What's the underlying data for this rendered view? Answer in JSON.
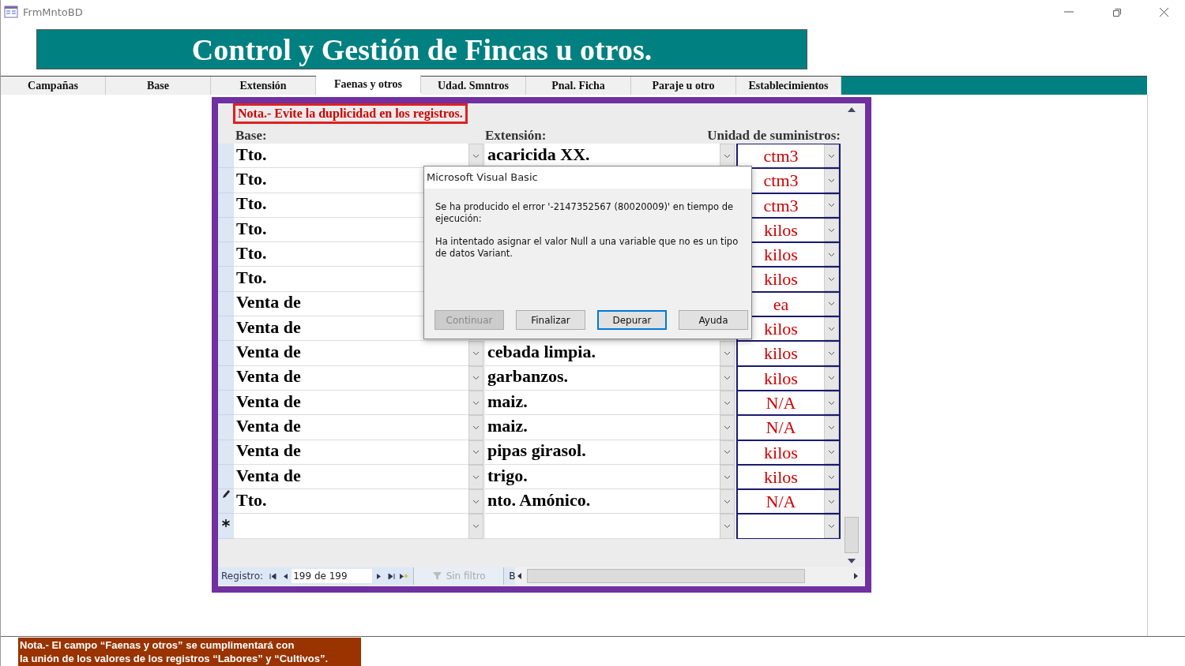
{
  "window": {
    "title": "FrmMntoBD"
  },
  "header": {
    "title": "Control y Gestión de Fincas u otros."
  },
  "tabs": [
    {
      "label": "Campañas",
      "selected": false
    },
    {
      "label": "Base",
      "selected": false
    },
    {
      "label": "Extensión",
      "selected": false
    },
    {
      "label": "Faenas y otros",
      "selected": true
    },
    {
      "label": "Udad. Smntros",
      "selected": false
    },
    {
      "label": "Pnal. Ficha",
      "selected": false
    },
    {
      "label": "Paraje u otro",
      "selected": false
    },
    {
      "label": "Establecimientos",
      "selected": false
    }
  ],
  "form": {
    "note": "Nota.- Evite la duplicidad en los registros.",
    "columns": [
      "Base:",
      "Extensión:",
      "Unidad de suministros:"
    ],
    "rows": [
      {
        "kind": "normal",
        "base": "Tto.",
        "extension": "acaricida XX.",
        "unit": "ctm3"
      },
      {
        "kind": "covered",
        "base": "Tto.",
        "unit": "ctm3"
      },
      {
        "kind": "covered",
        "base": "Tto.",
        "unit": "ctm3"
      },
      {
        "kind": "covered",
        "base": "Tto.",
        "unit": "kilos"
      },
      {
        "kind": "covered",
        "base": "Tto.",
        "unit": "kilos"
      },
      {
        "kind": "covered",
        "base": "Tto.",
        "unit": "kilos"
      },
      {
        "kind": "covered",
        "base": "Venta de",
        "unit": "ea"
      },
      {
        "kind": "covered",
        "base": "Venta de",
        "unit": "kilos"
      },
      {
        "kind": "normal",
        "base": "Venta de",
        "extension": "cebada limpia.",
        "unit": "kilos"
      },
      {
        "kind": "normal",
        "base": "Venta de",
        "extension": "garbanzos.",
        "unit": "kilos"
      },
      {
        "kind": "normal",
        "base": "Venta de",
        "extension": "maiz.",
        "unit": "N/A"
      },
      {
        "kind": "normal",
        "base": "Venta de",
        "extension": "maiz.",
        "unit": "N/A"
      },
      {
        "kind": "normal",
        "base": "Venta de",
        "extension": "pipas girasol.",
        "unit": "kilos"
      },
      {
        "kind": "normal",
        "base": "Venta de",
        "extension": "trigo.",
        "unit": "kilos"
      },
      {
        "kind": "editing",
        "base": "Tto.",
        "extension": "nto. Amónico.",
        "unit": "N/A"
      },
      {
        "kind": "new"
      }
    ],
    "navigator": {
      "label": "Registro:",
      "position": "199 de 199",
      "filter": "Sin filtro",
      "search": "B"
    }
  },
  "dialog": {
    "title": "Microsoft Visual Basic",
    "messages": [
      "Se ha producido el error '-2147352567 (80020009)' en tiempo de ejecución:",
      "Ha intentado asignar el valor Null a una variable que no es un tipo de datos Variant."
    ],
    "buttons": [
      {
        "label": "Continuar",
        "disabled": true,
        "selected": false
      },
      {
        "label": "Finalizar",
        "disabled": false,
        "selected": false
      },
      {
        "label": "Depurar",
        "disabled": false,
        "selected": true
      },
      {
        "label": "Ayuda",
        "disabled": false,
        "selected": false
      }
    ]
  },
  "footer_note": [
    "Nota.- El campo “Faenas y otros” se cumplimentará con",
    "la unión de los valores de los registros “Labores” y “Cultivos”."
  ]
}
